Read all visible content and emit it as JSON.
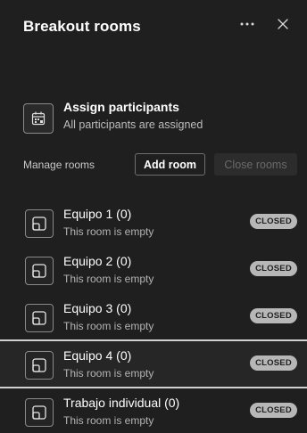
{
  "header": {
    "title": "Breakout rooms",
    "more_icon": "more-horizontal-icon",
    "close_icon": "close-icon"
  },
  "assign": {
    "icon": "assign-participants-icon",
    "title": "Assign participants",
    "subtitle": "All participants are assigned"
  },
  "manage": {
    "label": "Manage rooms",
    "add_button": "Add room",
    "close_button": "Close rooms"
  },
  "rooms": [
    {
      "name": "Equipo 1 (0)",
      "status": "This room is empty",
      "badge": "CLOSED"
    },
    {
      "name": "Equipo 2 (0)",
      "status": "This room is empty",
      "badge": "CLOSED"
    },
    {
      "name": "Equipo 3 (0)",
      "status": "This room is empty",
      "badge": "CLOSED"
    },
    {
      "name": "Equipo 4 (0)",
      "status": "This room is empty",
      "badge": "CLOSED"
    },
    {
      "name": "Trabajo individual (0)",
      "status": "This room is empty",
      "badge": "CLOSED"
    }
  ],
  "colors": {
    "background": "#1f1f1f",
    "badge": "#b7b7b7",
    "disabled_button": "#2c2c2c"
  }
}
